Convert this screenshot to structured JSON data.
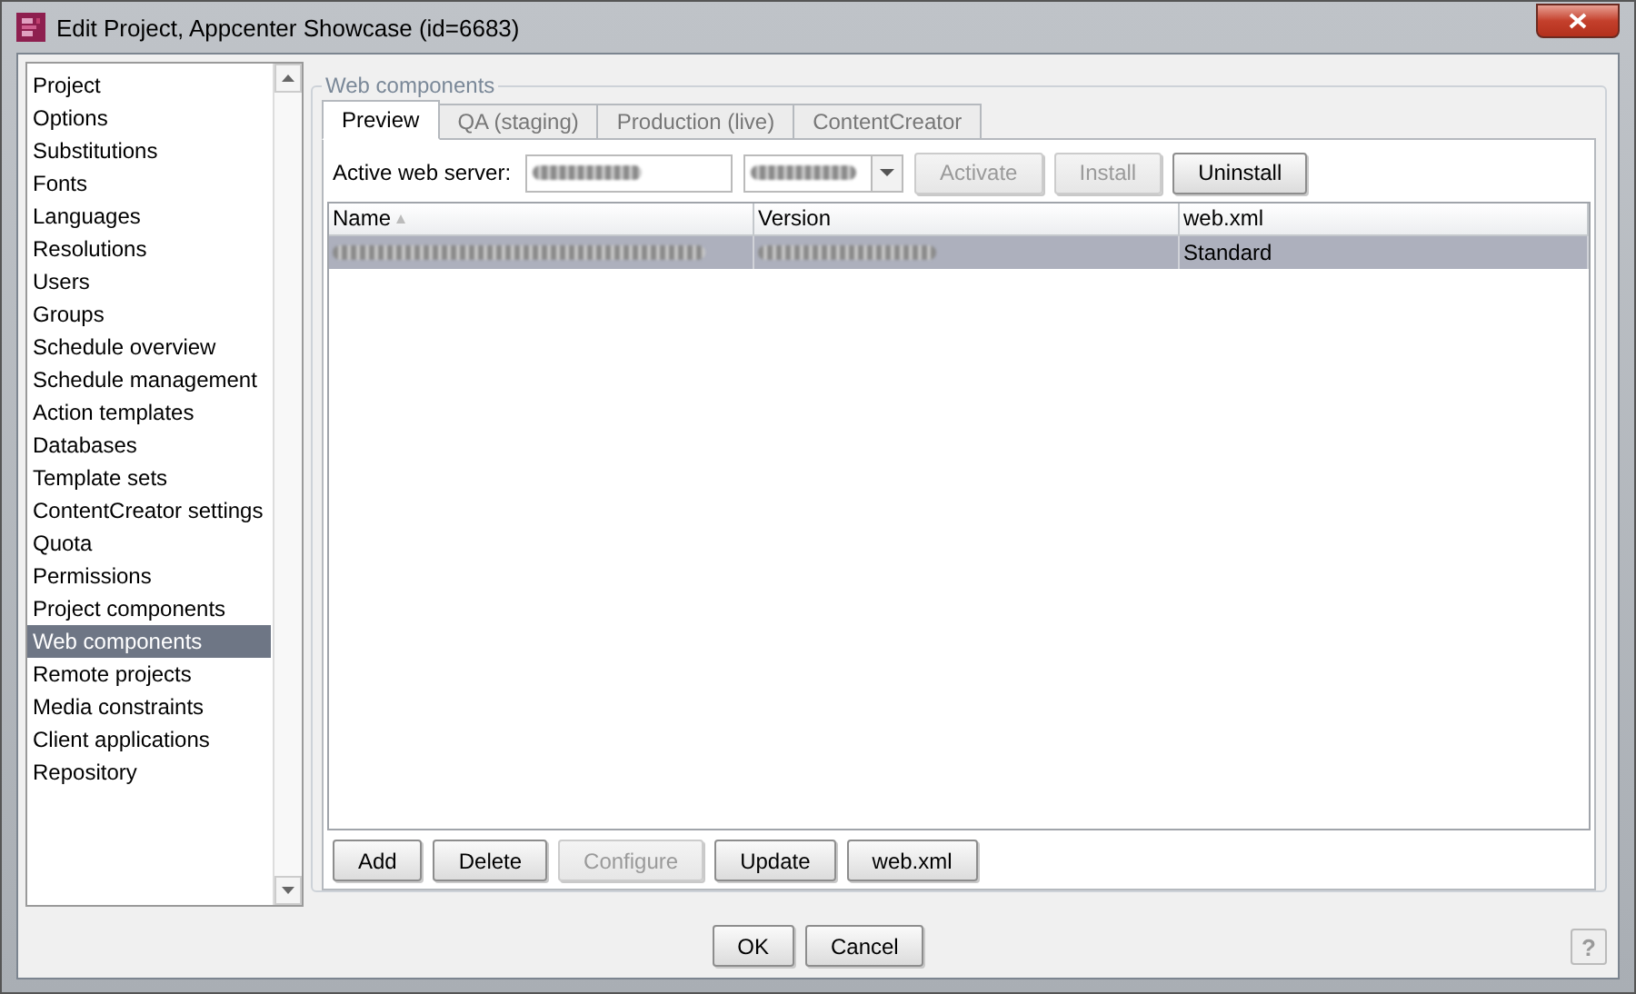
{
  "window": {
    "title": "Edit Project, Appcenter Showcase (id=6683)"
  },
  "sidebar": {
    "items": [
      {
        "label": "Project",
        "selected": false
      },
      {
        "label": "Options",
        "selected": false
      },
      {
        "label": "Substitutions",
        "selected": false
      },
      {
        "label": "Fonts",
        "selected": false
      },
      {
        "label": "Languages",
        "selected": false
      },
      {
        "label": "Resolutions",
        "selected": false
      },
      {
        "label": "Users",
        "selected": false
      },
      {
        "label": "Groups",
        "selected": false
      },
      {
        "label": "Schedule overview",
        "selected": false
      },
      {
        "label": "Schedule management",
        "selected": false
      },
      {
        "label": "Action templates",
        "selected": false
      },
      {
        "label": "Databases",
        "selected": false
      },
      {
        "label": "Template sets",
        "selected": false
      },
      {
        "label": "ContentCreator settings",
        "selected": false
      },
      {
        "label": "Quota",
        "selected": false
      },
      {
        "label": "Permissions",
        "selected": false
      },
      {
        "label": "Project components",
        "selected": false
      },
      {
        "label": "Web components",
        "selected": true
      },
      {
        "label": "Remote projects",
        "selected": false
      },
      {
        "label": "Media constraints",
        "selected": false
      },
      {
        "label": "Client applications",
        "selected": false
      },
      {
        "label": "Repository",
        "selected": false
      }
    ]
  },
  "group": {
    "title": "Web components"
  },
  "tabs": [
    {
      "label": "Preview",
      "selected": true
    },
    {
      "label": "QA (staging)",
      "selected": false
    },
    {
      "label": "Production (live)",
      "selected": false
    },
    {
      "label": "ContentCreator",
      "selected": false
    }
  ],
  "server": {
    "label": "Active web server:",
    "buttons": [
      {
        "label": "Activate",
        "disabled": true
      },
      {
        "label": "Install",
        "disabled": true
      },
      {
        "label": "Uninstall",
        "disabled": false
      }
    ]
  },
  "table": {
    "columns": [
      "Name",
      "Version",
      "web.xml"
    ],
    "rows": [
      {
        "selected": true,
        "cells": [
          "",
          "",
          "Standard"
        ]
      }
    ]
  },
  "actions": [
    {
      "label": "Add",
      "disabled": false
    },
    {
      "label": "Delete",
      "disabled": false
    },
    {
      "label": "Configure",
      "disabled": true
    },
    {
      "label": "Update",
      "disabled": false
    },
    {
      "label": "web.xml",
      "disabled": false
    }
  ],
  "dialog_buttons": [
    "OK",
    "Cancel"
  ],
  "help": "?"
}
